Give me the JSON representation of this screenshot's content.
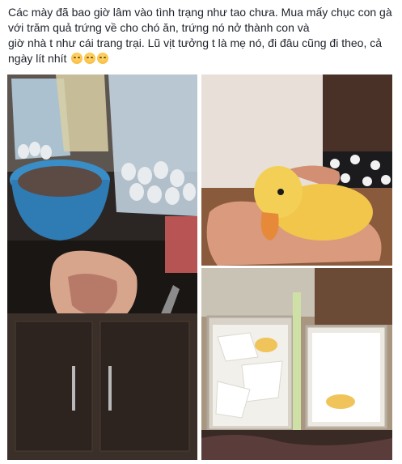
{
  "post": {
    "line1": "Các mày đã bao giờ lâm vào tình trạng như tao chưa. Mua mấy chục con gà",
    "line2": "với trăm quả trứng     về cho chó ăn,       trứng    nó nở        thành con và",
    "line3": "giờ nhà t như cái trang trại. Lũ vịt tưởng t là mẹ nó, đi đâu cũng đi theo, cả",
    "line4": "ngày lít nhít"
  },
  "emojis": [
    "sad-face-icon",
    "sad-face-icon",
    "sad-face-icon"
  ],
  "photos": [
    "kitchen-eggs-chicken-photo",
    "duckling-in-hand-photo",
    "ducklings-in-baskets-photo"
  ]
}
